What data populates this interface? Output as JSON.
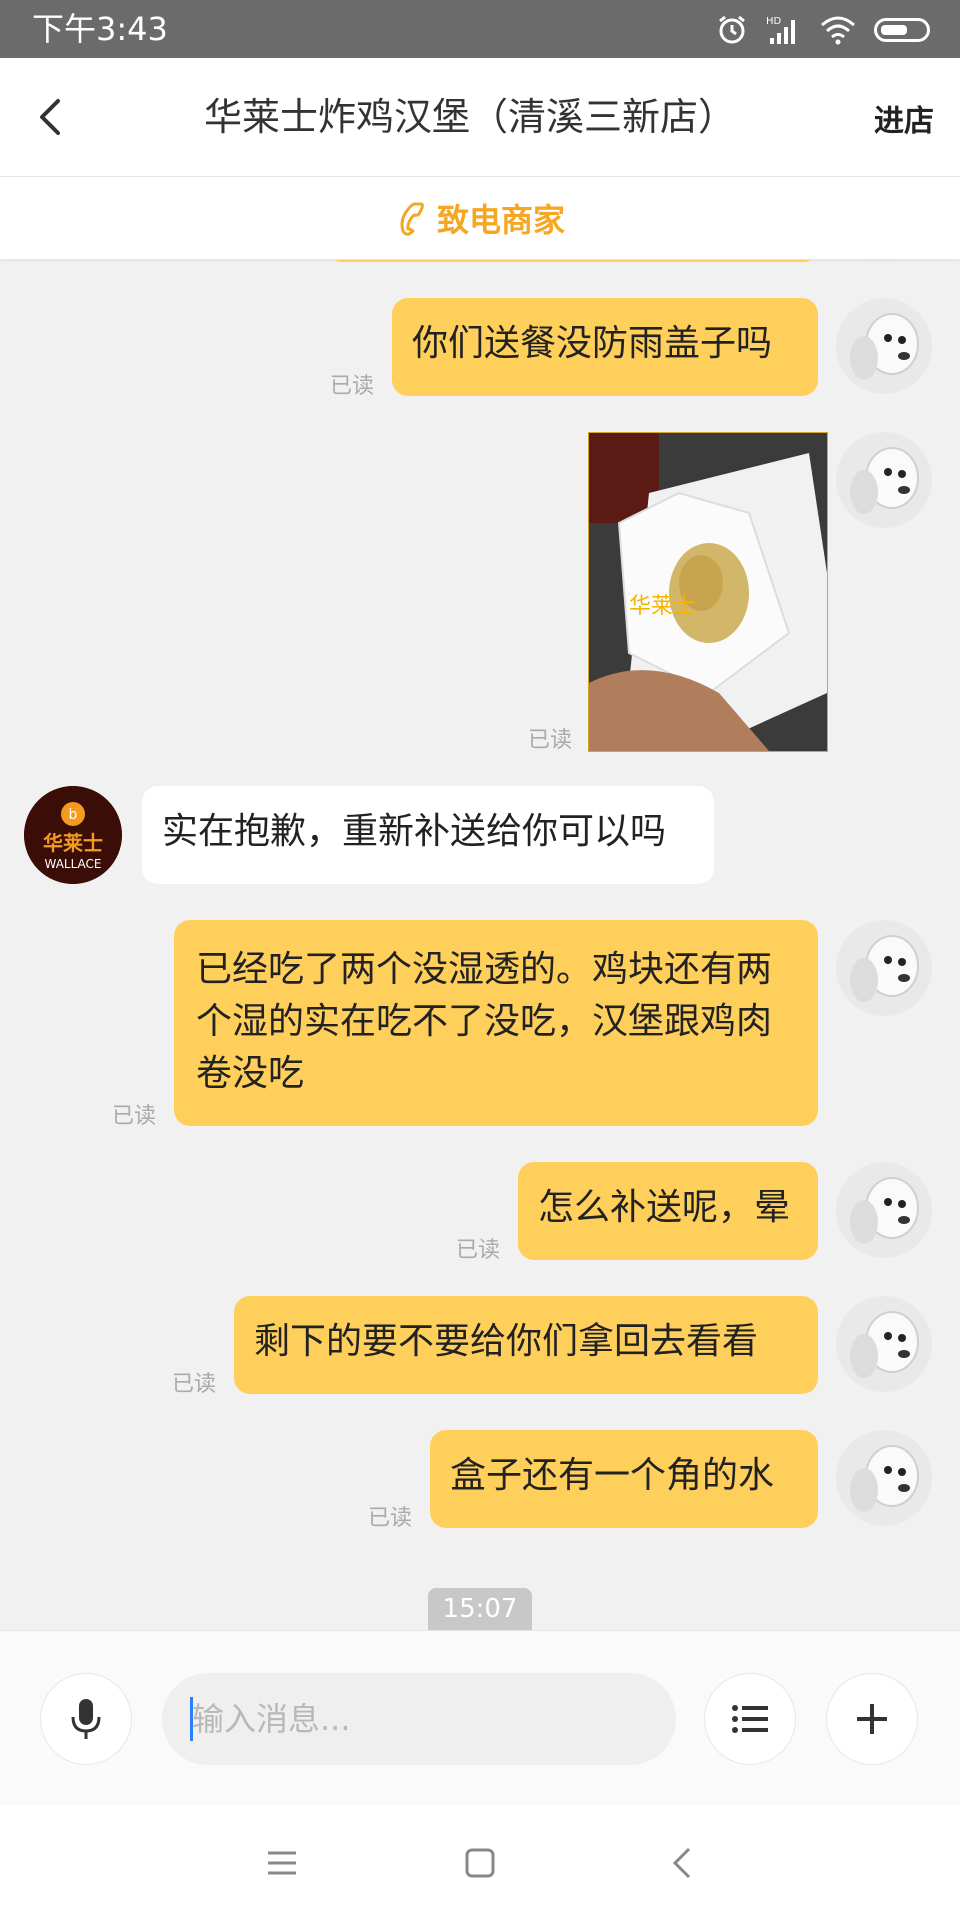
{
  "status_bar": {
    "time": "下午3:43",
    "icons": [
      "alarm-icon",
      "hd-signal-icon",
      "wifi-icon",
      "battery-icon"
    ]
  },
  "header": {
    "title": "华莱士炸鸡汉堡（清溪三新店）",
    "enter_store": "进店",
    "back_icon": "chevron-left-icon"
  },
  "call_banner": {
    "label": "致电商家",
    "icon": "phone-icon",
    "color": "#f5a623"
  },
  "messages": [
    {
      "side": "out",
      "type": "text",
      "text": "你们送餐没防雨盖子吗",
      "status": "已读"
    },
    {
      "side": "out",
      "type": "image",
      "status": "已读"
    },
    {
      "side": "in",
      "type": "text",
      "text": "实在抱歉，重新补送给你可以吗",
      "sender_avatar_text": "华莱士",
      "sender_avatar_sub": "WALLACE"
    },
    {
      "side": "out",
      "type": "text",
      "text": "已经吃了两个没湿透的。鸡块还有两个湿的实在吃不了没吃，汉堡跟鸡肉卷没吃",
      "status": "已读"
    },
    {
      "side": "out",
      "type": "text",
      "text": "怎么补送呢，晕",
      "status": "已读"
    },
    {
      "side": "out",
      "type": "text",
      "text": "剩下的要不要给你们拿回去看看",
      "status": "已读"
    },
    {
      "side": "out",
      "type": "text",
      "text": "盒子还有一个角的水",
      "status": "已读"
    }
  ],
  "time_divider": "15:07",
  "input_bar": {
    "placeholder": "输入消息...",
    "voice_icon": "microphone-icon",
    "menu_icon": "list-icon",
    "add_icon": "plus-icon"
  },
  "nav_bar": {
    "icons": [
      "menu-icon",
      "home-square-icon",
      "back-icon"
    ]
  },
  "colors": {
    "bubble_out": "#ffcf5c",
    "bubble_in": "#ffffff",
    "accent": "#f5a623"
  }
}
